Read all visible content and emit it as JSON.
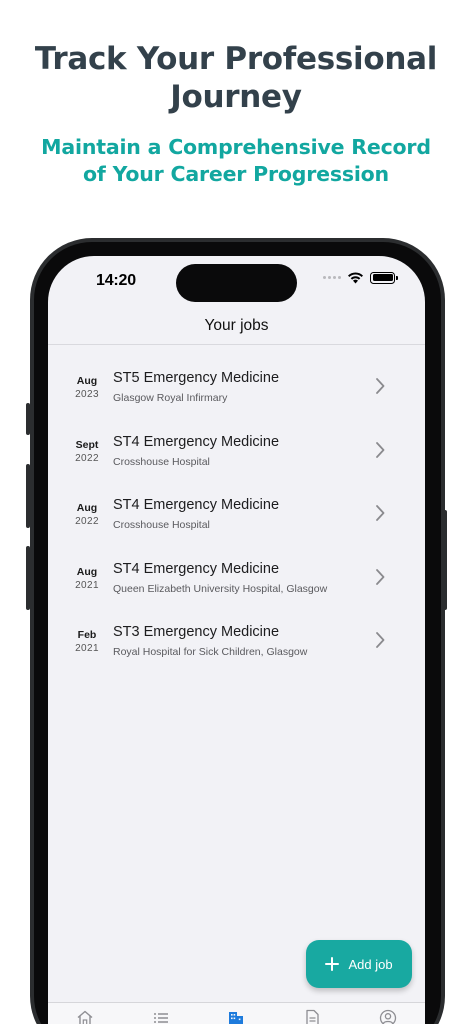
{
  "promo": {
    "headline_line1": "Track Your Professional",
    "headline_line2": "Journey",
    "subline_line1": "Maintain a Comprehensive Record",
    "subline_line2": "of Your Career Progression"
  },
  "status_bar": {
    "time": "14:20",
    "icons": [
      "cellular-dots-icon",
      "wifi-icon",
      "battery-icon"
    ]
  },
  "nav": {
    "title": "Your jobs"
  },
  "jobs": [
    {
      "month": "Aug",
      "year": "2023",
      "title": "ST5 Emergency Medicine",
      "place": "Glasgow Royal Infirmary"
    },
    {
      "month": "Sept",
      "year": "2022",
      "title": "ST4 Emergency Medicine",
      "place": "Crosshouse Hospital"
    },
    {
      "month": "Aug",
      "year": "2022",
      "title": "ST4 Emergency Medicine",
      "place": "Crosshouse Hospital"
    },
    {
      "month": "Aug",
      "year": "2021",
      "title": "ST4 Emergency Medicine",
      "place": "Queen Elizabeth University Hospital, Glasgow"
    },
    {
      "month": "Feb",
      "year": "2021",
      "title": "ST3 Emergency Medicine",
      "place": "Royal Hospital for Sick Children, Glasgow"
    }
  ],
  "fab": {
    "label": "Add job",
    "icon": "plus-icon"
  },
  "tabbar": {
    "tabs": [
      "home-icon",
      "list-icon",
      "building-icon",
      "document-icon",
      "profile-icon"
    ],
    "active_tab": "building-icon"
  },
  "colors": {
    "accent": "#18a9a1",
    "headline": "#33414b",
    "subline": "#12a7a0",
    "active_tab": "#1e7bdc",
    "inactive_tab": "#8e8e93"
  }
}
